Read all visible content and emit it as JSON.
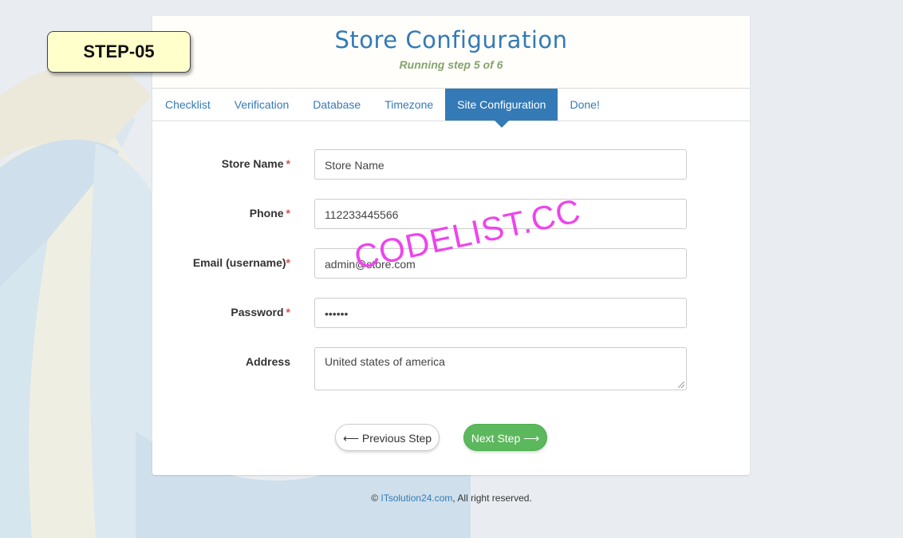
{
  "step_badge": "STEP-05",
  "header": {
    "title": "Store Configuration",
    "subtitle": "Running step 5 of 6"
  },
  "tabs": [
    {
      "label": "Checklist",
      "active": false
    },
    {
      "label": "Verification",
      "active": false
    },
    {
      "label": "Database",
      "active": false
    },
    {
      "label": "Timezone",
      "active": false
    },
    {
      "label": "Site Configuration",
      "active": true
    },
    {
      "label": "Done!",
      "active": false
    }
  ],
  "form": {
    "store_name": {
      "label": "Store Name",
      "required_mark": "*",
      "value": "Store Name"
    },
    "phone": {
      "label": "Phone",
      "required_mark": "*",
      "value": "112233445566"
    },
    "email": {
      "label": "Email (username)",
      "required_mark": "*",
      "value": "admin@store.com"
    },
    "password": {
      "label": "Password",
      "required_mark": "*",
      "value": "••••••"
    },
    "address": {
      "label": "Address",
      "value": "United states of america"
    }
  },
  "buttons": {
    "previous": "⟵ Previous Step",
    "next": "Next Step ⟶"
  },
  "footer": {
    "copyright_symbol": "©",
    "link_text": "ITsolution24.com",
    "suffix": ", All right reserved."
  },
  "watermark": "CODELIST.CC",
  "colors": {
    "accent": "#337ab7",
    "success": "#5cb85c",
    "required": "#d9534f",
    "subtitle": "#84a46c",
    "badge_bg": "#ffffcc"
  }
}
